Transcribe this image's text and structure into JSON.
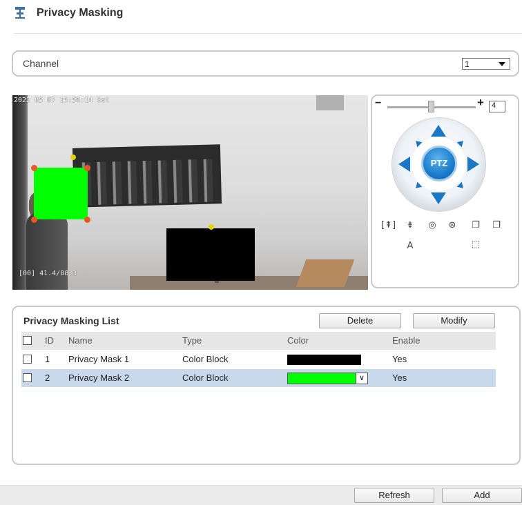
{
  "header": {
    "title": "Privacy Masking",
    "icon": "privacy-masking-icon"
  },
  "channel": {
    "label": "Channel",
    "selected": "1"
  },
  "video": {
    "osd_time": "2022 05 07 15:56:14 Sat",
    "osd_coords": "[00] 41.4/88.3",
    "masks": [
      {
        "name": "Privacy Mask 1",
        "color": "#000000"
      },
      {
        "name": "Privacy Mask 2",
        "color": "#00ff00"
      }
    ]
  },
  "ptz": {
    "zoom_minus": "−",
    "zoom_plus": "+",
    "zoom_value": "4",
    "center_label": "PTZ",
    "tools": [
      {
        "icon": "zoom-in-icon",
        "glyph": "[⇞]"
      },
      {
        "icon": "zoom-out-icon",
        "glyph": "⇟"
      },
      {
        "icon": "focus-near-icon",
        "glyph": "◎"
      },
      {
        "icon": "focus-far-icon",
        "glyph": "⊛"
      },
      {
        "icon": "iris-open-icon",
        "glyph": "❐"
      },
      {
        "icon": "iris-close-icon",
        "glyph": "❐"
      },
      {
        "icon": "auto-focus-icon",
        "glyph": "A"
      },
      {
        "icon": "fullscreen-icon",
        "glyph": "⬚"
      }
    ]
  },
  "list": {
    "title": "Privacy Masking List",
    "delete_label": "Delete",
    "modify_label": "Modify",
    "columns": {
      "id": "ID",
      "name": "Name",
      "type": "Type",
      "color": "Color",
      "enable": "Enable"
    },
    "rows": [
      {
        "id": "1",
        "name": "Privacy Mask 1",
        "type": "Color Block",
        "color": "#000000",
        "enable": "Yes"
      },
      {
        "id": "2",
        "name": "Privacy Mask 2",
        "type": "Color Block",
        "color": "#00ff00",
        "enable": "Yes"
      }
    ]
  },
  "footer": {
    "refresh_label": "Refresh",
    "add_label": "Add"
  }
}
